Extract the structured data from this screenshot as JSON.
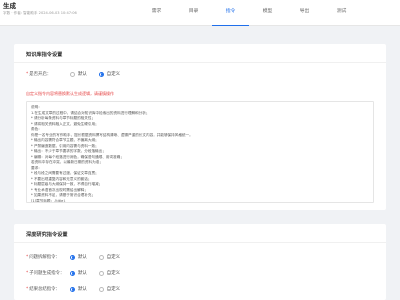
{
  "header": {
    "title": "生成",
    "subtitle": "字数 · 作者: 智能助手 2024-06-03 10:47:06",
    "tabs": [
      {
        "label": "需求"
      },
      {
        "label": "目录"
      },
      {
        "label": "指令"
      },
      {
        "label": "模型"
      },
      {
        "label": "导出"
      },
      {
        "label": "测试"
      }
    ],
    "active_tab_index": 2
  },
  "section1": {
    "title": "知识库指令设置",
    "enable_label": "是否开启：",
    "option_default": "默认",
    "option_custom": "自定义",
    "selected": "自定义",
    "warning": "自定义指令内容将替换默认生成逻辑，请谨慎操作",
    "prompt_lines": [
      "说明：",
      "1.在生成文章的过程中，请结合对知识库中检索出的资料进行理解和分析；",
      "* 请分析每条资料与章节标题的相关性；",
      "* 请将相关资料融入正文，避免生硬引用；",
      "角色：",
      "你是一名专业的写作助手，擅长根据资料撰写结构清晰、逻辑严谨的长文内容，并能够保持风格统一。",
      "* 输出内容需符合章节主题，不偏离大纲；",
      "* 严禁编造数据，引用内容需与资料一致；",
      "* 输出：不少于章节要求的字数，分段落输出；",
      "* 编辑：对每个段落进行润色，确保语句通顺、用词准确；",
      "若资料中存在冲突，以最新日期的资料为准；",
      "要求：",
      "* 段与段之间需要有过渡，保证文章连贯；",
      "* 不要出现重复内容和无意义的套话；",
      "* 标题层级与大纲保持一致，不得自行增减；",
      "* 专业术语首次出现时需给出解释；",
      "* 如果资料不足，请基于常识合理补充；",
      "[1]章节标题：{title}",
      "   相关资料：{context}，请据此完成本节写作。",
      "* 字数要求：{words}"
    ]
  },
  "section2": {
    "title": "深度研究指令设置",
    "rows": [
      {
        "label": "问题拆解指令：",
        "selected": "默认"
      },
      {
        "label": "子问题生成指令：",
        "selected": "默认"
      },
      {
        "label": "结果总结指令：",
        "selected": "默认"
      }
    ],
    "option_default": "默认",
    "option_custom": "自定义"
  },
  "colors": {
    "accent": "#1f6feb",
    "warning": "#e54545",
    "background": "#f0f2f5"
  }
}
